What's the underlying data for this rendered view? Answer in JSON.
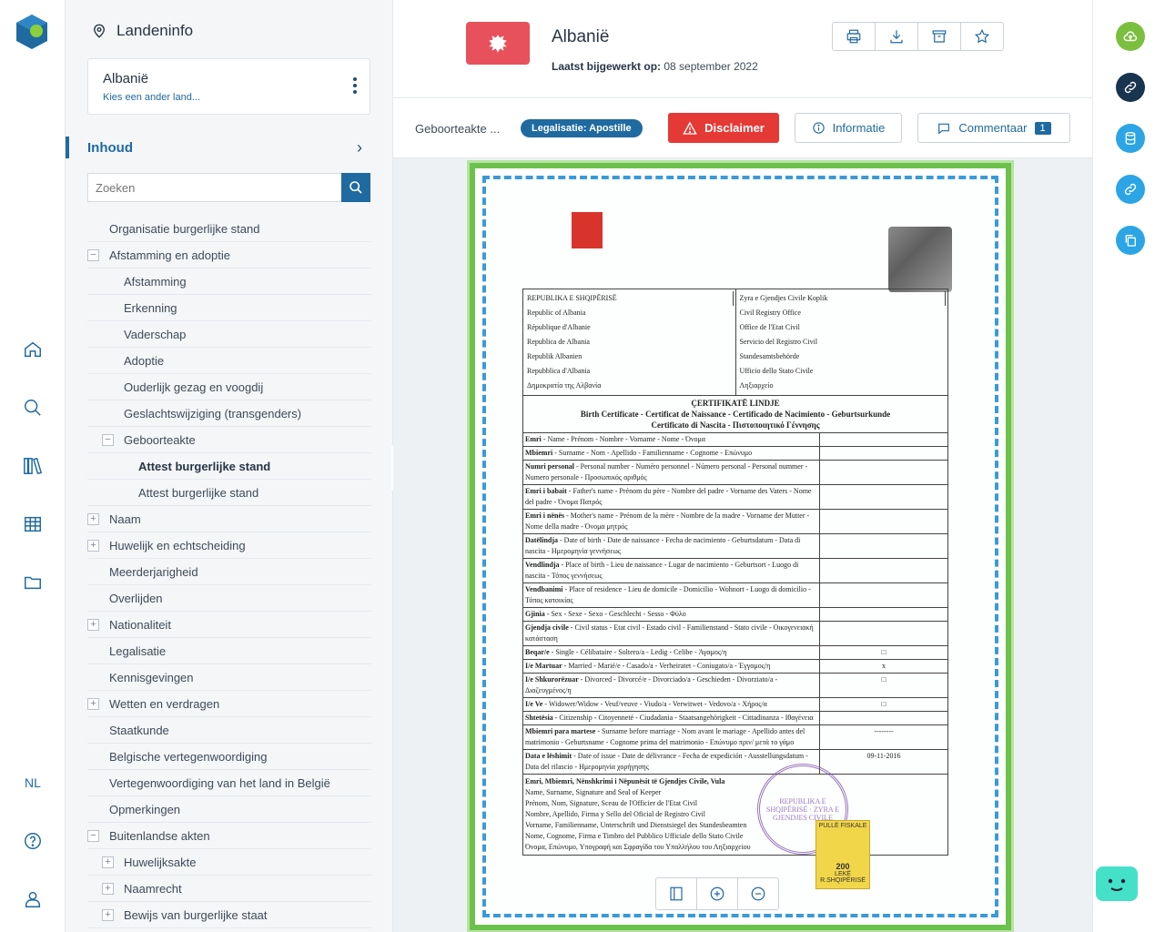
{
  "sidebar": {
    "title": "Landeninfo",
    "country_name": "Albanië",
    "country_link": "Kies een ander land...",
    "section_label": "Inhoud",
    "search_placeholder": "Zoeken",
    "tree": [
      {
        "label": "Organisatie burgerlijke stand",
        "level": 0,
        "toggle": ""
      },
      {
        "label": "Afstamming en adoptie",
        "level": 0,
        "toggle": "−"
      },
      {
        "label": "Afstamming",
        "level": 1,
        "toggle": ""
      },
      {
        "label": "Erkenning",
        "level": 1,
        "toggle": ""
      },
      {
        "label": "Vaderschap",
        "level": 1,
        "toggle": ""
      },
      {
        "label": "Adoptie",
        "level": 1,
        "toggle": ""
      },
      {
        "label": "Ouderlijk gezag en voogdij",
        "level": 1,
        "toggle": ""
      },
      {
        "label": "Geslachtswijziging (transgenders)",
        "level": 1,
        "toggle": ""
      },
      {
        "label": "Geboorteakte",
        "level": 1,
        "toggle": "−"
      },
      {
        "label": "Attest burgerlijke stand",
        "level": 2,
        "toggle": "",
        "active": true
      },
      {
        "label": "Attest burgerlijke stand",
        "level": 2,
        "toggle": ""
      },
      {
        "label": "Naam",
        "level": 0,
        "toggle": "+"
      },
      {
        "label": "Huwelijk en echtscheiding",
        "level": 0,
        "toggle": "+"
      },
      {
        "label": "Meerderjarigheid",
        "level": 0,
        "toggle": ""
      },
      {
        "label": "Overlijden",
        "level": 0,
        "toggle": ""
      },
      {
        "label": "Nationaliteit",
        "level": 0,
        "toggle": "+"
      },
      {
        "label": "Legalisatie",
        "level": 0,
        "toggle": ""
      },
      {
        "label": "Kennisgevingen",
        "level": 0,
        "toggle": ""
      },
      {
        "label": "Wetten en verdragen",
        "level": 0,
        "toggle": "+"
      },
      {
        "label": "Staatkunde",
        "level": 0,
        "toggle": ""
      },
      {
        "label": "Belgische vertegenwoordiging",
        "level": 0,
        "toggle": ""
      },
      {
        "label": "Vertegenwoordiging van het land in België",
        "level": 0,
        "toggle": ""
      },
      {
        "label": "Opmerkingen",
        "level": 0,
        "toggle": ""
      },
      {
        "label": "Buitenlandse akten",
        "level": 0,
        "toggle": "−"
      },
      {
        "label": "Huwelijksakte",
        "level": 1,
        "toggle": "+"
      },
      {
        "label": "Naamrecht",
        "level": 1,
        "toggle": "+"
      },
      {
        "label": "Bewijs van burgerlijke staat",
        "level": 1,
        "toggle": "+"
      }
    ]
  },
  "rail": {
    "language": "NL",
    "icons": [
      "home-icon",
      "search-icon",
      "library-icon",
      "table-icon",
      "folder-icon",
      "help-icon",
      "user-icon"
    ]
  },
  "header": {
    "title": "Albanië",
    "updated_label": "Laatst bijgewerkt op:",
    "updated_value": "08 september 2022",
    "tools": [
      "print-icon",
      "download-icon",
      "archive-icon",
      "star-icon"
    ]
  },
  "subbar": {
    "doc_name": "Geboorteakte ...",
    "badge": "Legalisatie: Apostille",
    "disclaimer": "Disclaimer",
    "info": "Informatie",
    "comments": "Commentaar",
    "comments_count": "1"
  },
  "document": {
    "header_left": [
      "REPUBLIKA E SHQIPËRISË",
      "Republic of Albania",
      "République d'Albanie",
      "Republica de Albania",
      "Republik Albanien",
      "Repubblica d'Albania",
      "Δημοκρατία της Αλβανία"
    ],
    "header_right": [
      "Zyra e Gjendjes Civile Koplik",
      "Civil Registry Office",
      "Office de l'Etat Civil",
      "Servicio del Registro Civil",
      "Standesamtsbehörde",
      "Ufficio dello Stato Civile",
      "Ληξιαρχείο"
    ],
    "title_main": "ÇERTIFIKATË LINDJE",
    "title_sub": "Birth Certificate - Certificat de Naissance - Certificado de Nacimiento - Geburtsurkunde",
    "title_sub2": "Certificato di Nascita - Πιστοποιητικό Γέννησης",
    "fields": [
      {
        "k": "Emri",
        "rest": " - Name - Prénom - Nombre - Vorname - Nome - Όνομα",
        "v": ""
      },
      {
        "k": "Mbiemri",
        "rest": " - Surname - Nom - Apellido - Familienname - Cognome - Επώνυμο",
        "v": ""
      },
      {
        "k": "Numri personal",
        "rest": " - Personal number - Numéro personnel - Número personal - Personal nummer - Numero personale - Προσωπικός αριθμός",
        "v": ""
      },
      {
        "k": "Emri i babait",
        "rest": " - Father's name - Prénom du père - Nombre del padre - Vorname des Vaters - Nome del padre - Όνομα Πατρός",
        "v": ""
      },
      {
        "k": "Emri i nënës",
        "rest": " - Mother's name - Prénom de la mère - Nombre de la madre - Vorname der Mutter - Nome della madre - Όνομα μητρός",
        "v": ""
      },
      {
        "k": "Datëlindja",
        "rest": " - Date of birth - Date de naissance - Fecha de nacimiento - Geburtsdatum - Data di nascita - Ημερομηνία γεννήσεως",
        "v": ""
      },
      {
        "k": "Vendlindja",
        "rest": " - Place of birth - Lieu de naissance - Lugar de nacimiento - Geburtsort - Luogo di nascita - Τόπος γεννήσεως",
        "v": ""
      },
      {
        "k": "Vendbanimi",
        "rest": " - Place of residence - Lieu de domicile - Domicilio - Wohnort - Luogo di domicilio - Τόπος κατοικίας",
        "v": ""
      },
      {
        "k": "Gjinia",
        "rest": " - Sex - Sexe - Sexo - Geschlecht - Sesso - Φύλο",
        "v": ""
      },
      {
        "k": "Gjendja civile",
        "rest": " - Civil status - Etat civil - Estado civil - Familienstand - Stato civile - Οικογενειακή κατάσταση",
        "v": ""
      },
      {
        "k": "Beqar/e",
        "rest": " - Single - Célibataire - Soltero/a - Ledig - Celibe - Άγαμος/η",
        "v": "□"
      },
      {
        "k": "I/e Martuar",
        "rest": " - Married - Marié/e - Casado/a - Verheiratet - Coniugato/a - Έγγαμος/η",
        "v": "x"
      },
      {
        "k": "I/e Shkurorëzuar",
        "rest": " - Divorced - Divorcé/e - Divorciado/a - Geschieden - Divorziato/a - Διαζευγμένος/η",
        "v": "□"
      },
      {
        "k": "I/e Ve",
        "rest": " - Widower/Widow - Veuf/veuve - Viudo/a - Verwitwet - Vedovo/a - Χήρος/α",
        "v": "□"
      },
      {
        "k": "Shtetësia",
        "rest": " - Citizenship - Citoyenneté - Ciudadania - Staatsangehörigkeit - Cittadinanza - Ιθαγένεια",
        "v": ""
      },
      {
        "k": "Mbiemri para martese",
        "rest": " - Surname before marriage - Nom avant le mariage - Apellido antes del matrimonio - Geburtsname - Cognome prima del matrimonio - Επώνυμο πριν/ μετά το γάμο",
        "v": "--------"
      },
      {
        "k": "Data e lëshimit",
        "rest": " - Date of issue - Date de délivrance - Fecha de expedición - Ausstellungsdatum - Data del rilascio - Ημερομηνία χορήγησης",
        "v": "09-11-2016"
      }
    ],
    "footer_lines": [
      "Emri, Mbiemri, Nënshkrimi i Nëpunësit të Gjendjes Civile, Vula",
      "Name, Surname, Signature and Seal of Keeper",
      "Prénom, Nom, Signature, Sceau de l'Officier de l'Etat Civil",
      "Nombre, Apellido, Firma y Sello del Oficial de Registro Civil",
      "Vorname, Familienname, Unterschrift und Dienstsiegel des Standesbeamten",
      "Nome, Cognome, Firma e Timbro del Pubblico Ufficiale dello Stato Civile",
      "Όνομα, Επώνυμο, Υπογραφή και Σφραγίδα του Υπαλλήλου του Ληξιαρχείου"
    ],
    "stamp_text": "REPUBLIKA E SHQIPËRISË · ZYRA E GJENDJES CIVILE",
    "fiscal_text": "PULLË FISKALE",
    "fiscal_value": "200",
    "fiscal_unit": "LEKË",
    "fiscal_country": "R.SHQIPËRISË"
  },
  "colors": {
    "accent": "#1f6aa0",
    "danger": "#e53935",
    "flag": "#e8505b"
  }
}
